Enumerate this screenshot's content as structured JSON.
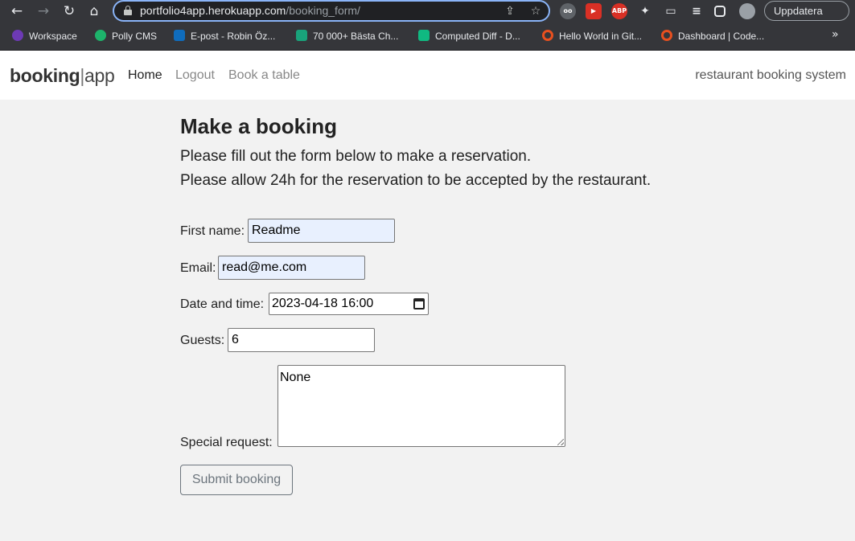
{
  "browser": {
    "url_host": "portfolio4app.herokuapp.com",
    "url_path": "/booking_form/",
    "update_label": "Uppdatera",
    "bookmarks": [
      {
        "label": "Workspace",
        "icon": "workspace-icon",
        "color": "#6d3ab5"
      },
      {
        "label": "Polly CMS",
        "icon": "polly-icon",
        "color": "#1db36b"
      },
      {
        "label": "E-post - Robin Öz...",
        "icon": "outlook-icon",
        "color": "#0f6cbd"
      },
      {
        "label": "70 000+ Bästa Ch...",
        "icon": "d-icon",
        "color": "#19a37b"
      },
      {
        "label": "Computed Diff - D...",
        "icon": "diff-icon",
        "color": "#10b981"
      },
      {
        "label": "Hello World in Git...",
        "icon": "ring-icon",
        "color": "#e8501f"
      },
      {
        "label": "Dashboard | Code...",
        "icon": "ring-icon",
        "color": "#e8501f"
      }
    ]
  },
  "navbar": {
    "brand_bold": "booking",
    "brand_sep": "|",
    "brand_light": "app",
    "links": [
      "Home",
      "Logout",
      "Book a table"
    ],
    "tagline": "restaurant booking system"
  },
  "main": {
    "title": "Make a booking",
    "intro_1": "Please fill out the form below to make a reservation.",
    "intro_2": "Please allow 24h for the reservation to be accepted by the restaurant.",
    "first_name_label": "First name:",
    "first_name_value": "Readme",
    "email_label": "Email:",
    "email_value": "read@me.com",
    "date_label": "Date and time:",
    "date_value": "2023-04-18 16:00",
    "guests_label": "Guests:",
    "guests_value": "6",
    "special_label": "Special request:",
    "special_value": "None",
    "submit_label": "Submit booking"
  }
}
